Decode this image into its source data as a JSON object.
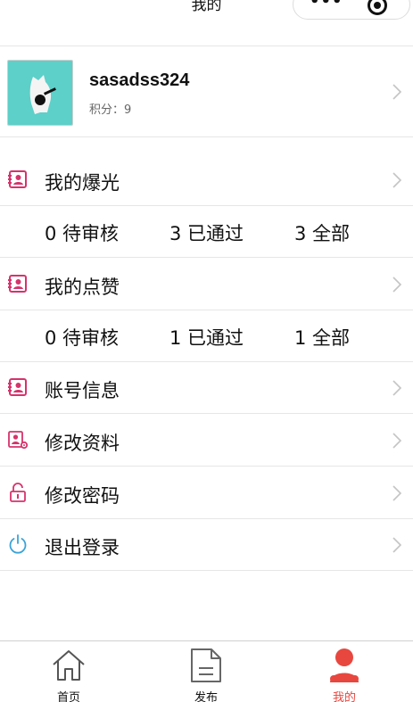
{
  "header": {
    "title": "我的",
    "capsule_dots": "•••"
  },
  "profile": {
    "username": "sasadss324",
    "points": "积分：9"
  },
  "exposure": {
    "label": "我的爆光",
    "stats": [
      "0 待审核",
      "3 已通过",
      "3 全部"
    ]
  },
  "likes": {
    "label": "我的点赞",
    "stats": [
      "0 待审核",
      "1 已通过",
      "1 全部"
    ]
  },
  "menu": {
    "account_info": "账号信息",
    "edit_profile": "修改资料",
    "change_password": "修改密码",
    "logout": "退出登录"
  },
  "tabbar": {
    "home": "首页",
    "publish": "发布",
    "mine": "我的"
  },
  "colors": {
    "accent_red": "#e8473f",
    "icon_pink": "#d6336c",
    "icon_blue": "#3aa3d8",
    "avatar_bg": "#5cd0c9"
  }
}
